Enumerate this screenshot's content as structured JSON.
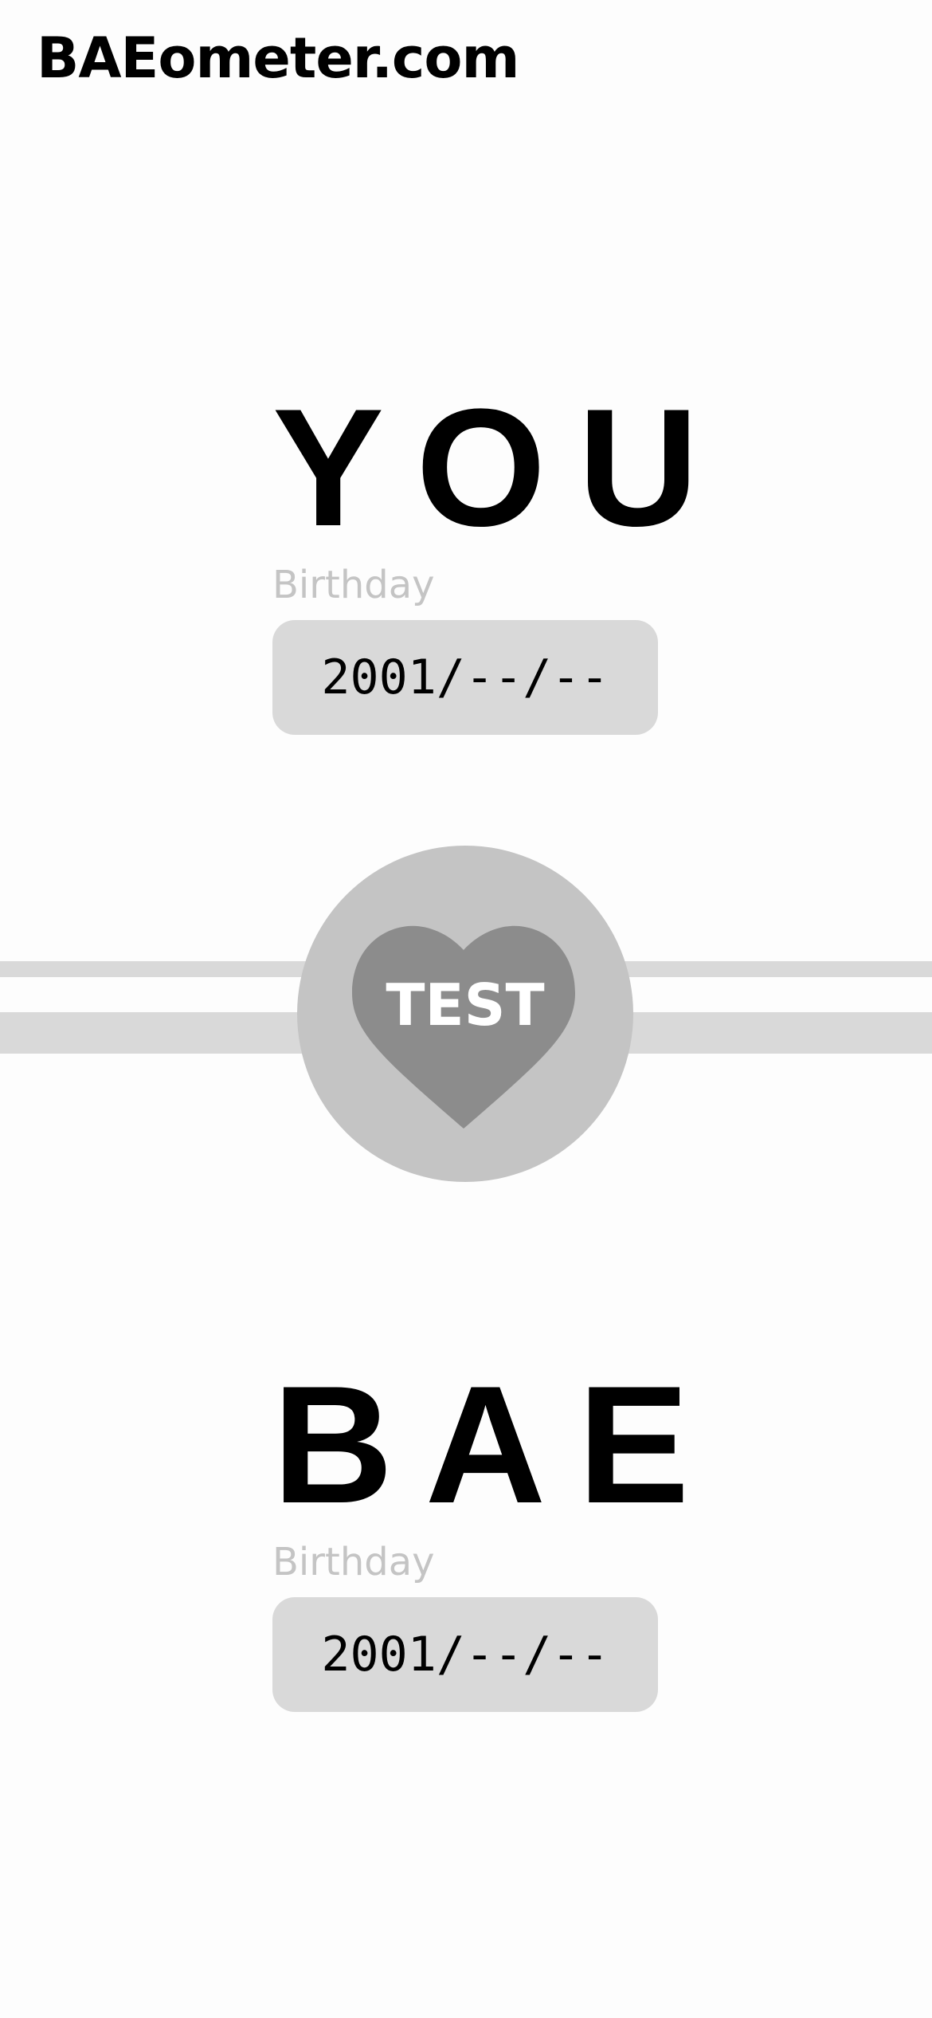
{
  "header": {
    "site_title": "BAEometer.com"
  },
  "you": {
    "heading": "YOU",
    "birthday_label": "Birthday",
    "birthday_value": "2001/--/--"
  },
  "test_button": {
    "label": "TEST",
    "icon": "heart-icon"
  },
  "bae": {
    "heading": "BAE",
    "birthday_label": "Birthday",
    "birthday_value": "2001/--/--"
  },
  "colors": {
    "background": "#fdfdfd",
    "field_bg": "#d9d9d9",
    "circle_bg": "#c4c4c4",
    "heart": "#8c8c8c",
    "label_gray": "#c4c4c4",
    "text": "#000000"
  }
}
